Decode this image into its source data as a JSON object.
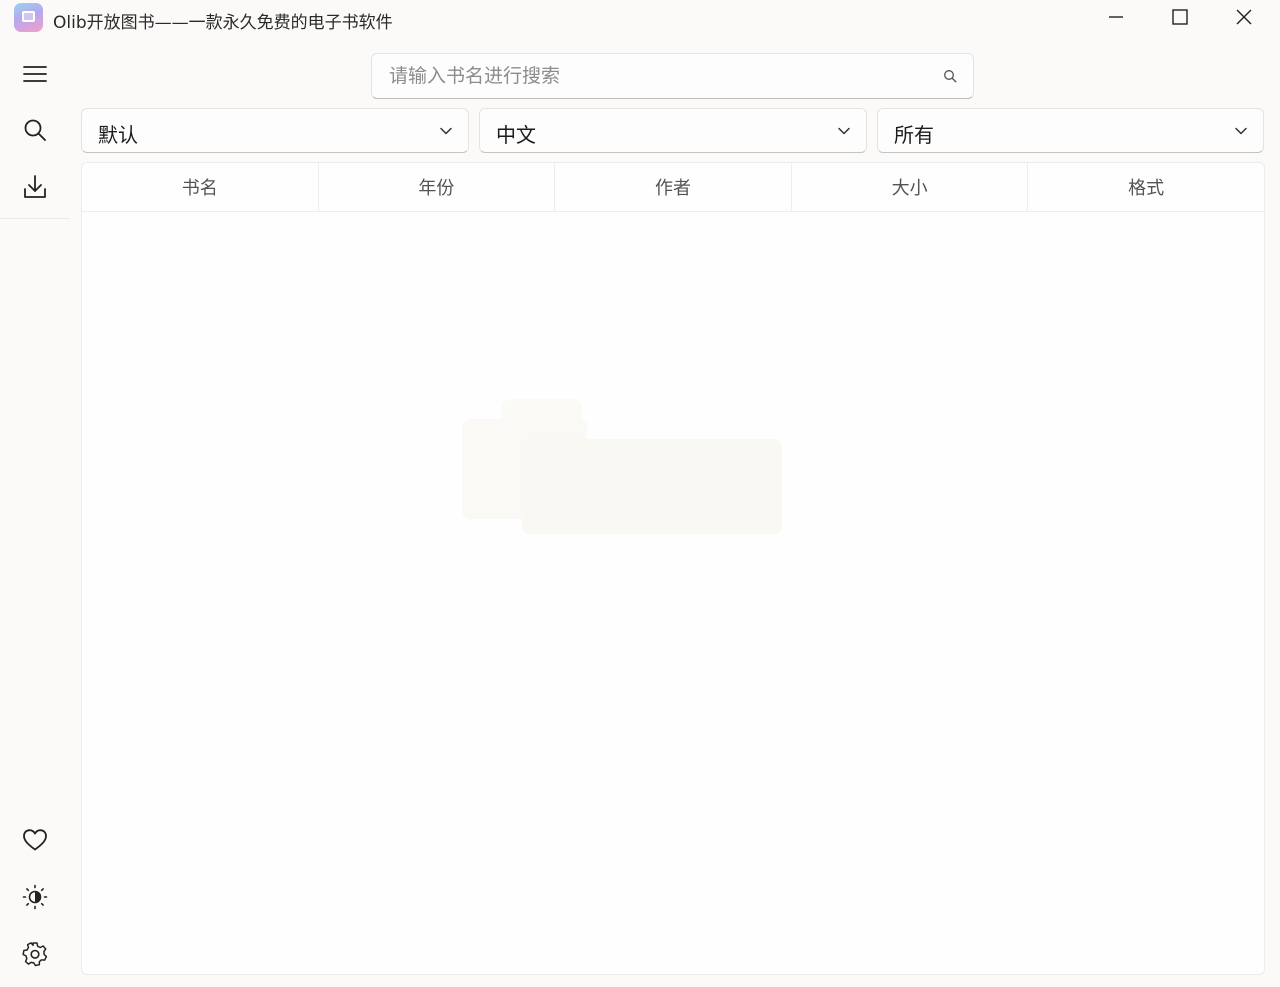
{
  "window": {
    "title": "Olib开放图书——一款永久免费的电子书软件"
  },
  "sidebar": {
    "top_items": [
      {
        "name": "menu",
        "icon": "hamburger-menu-icon"
      },
      {
        "name": "search",
        "icon": "search-icon"
      },
      {
        "name": "downloads",
        "icon": "download-icon"
      }
    ],
    "bottom_items": [
      {
        "name": "favorites",
        "icon": "heart-icon"
      },
      {
        "name": "theme",
        "icon": "brightness-icon"
      },
      {
        "name": "settings",
        "icon": "gear-icon"
      }
    ]
  },
  "search": {
    "placeholder": "请输入书名进行搜索",
    "value": ""
  },
  "filters": {
    "sort": {
      "selected": "默认"
    },
    "language": {
      "selected": "中文"
    },
    "format": {
      "selected": "所有"
    }
  },
  "table": {
    "columns": [
      "书名",
      "年份",
      "作者",
      "大小",
      "格式"
    ],
    "rows": []
  },
  "colors": {
    "background": "#fbfaf9",
    "panel": "#fefefe",
    "border": "#e6e3e0",
    "text": "#1f1f1f",
    "muted_text": "#8e8c8a"
  }
}
